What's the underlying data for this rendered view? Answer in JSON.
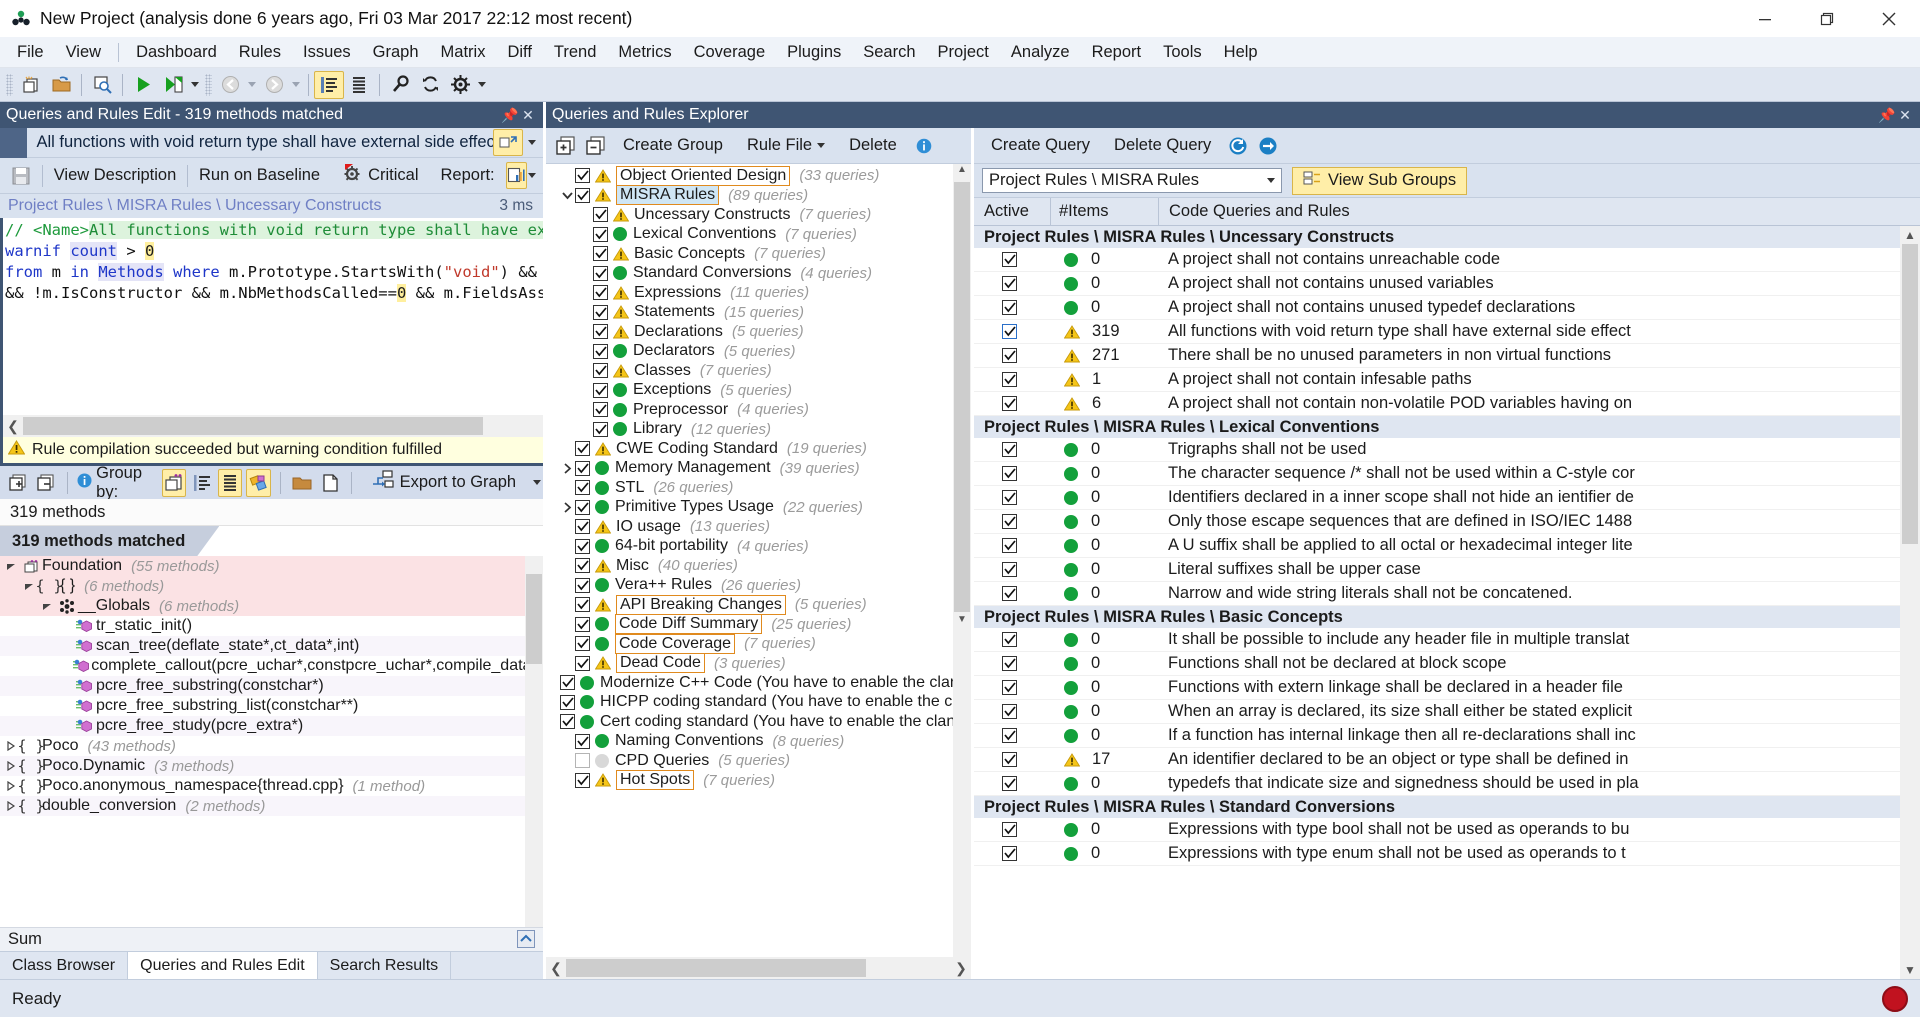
{
  "titlebar": {
    "app_icon": "cppdepend-logo-icon",
    "title": "New Project  (analysis done 6 years ago, Fri 03 Mar 2017  22:12 most recent)",
    "minimize": "—",
    "maximize": "❐",
    "close": "✕"
  },
  "menubar": {
    "items": [
      "File",
      "View",
      "Dashboard",
      "Rules",
      "Issues",
      "Graph",
      "Matrix",
      "Diff",
      "Trend",
      "Metrics",
      "Coverage",
      "Plugins",
      "Search",
      "Project",
      "Analyze",
      "Report",
      "Tools",
      "Help"
    ]
  },
  "left": {
    "panel_title": "Queries and Rules Edit  - 319 methods matched",
    "rule_title": "All functions with void return type shall have external side effect(s)",
    "tools": {
      "save": "",
      "view_description": "View Description",
      "run_on_baseline": "Run on Baseline",
      "critical": "Critical",
      "report": "Report:"
    },
    "breadcrumb": "Project Rules \\ MISRA Rules \\ Uncessary Constructs",
    "duration": "3 ms",
    "code": [
      [
        {
          "t": "// <Name>",
          "c": "c-green"
        },
        {
          "t": "All functions with void return type shall have external s",
          "c": "c-greenbg"
        }
      ],
      [
        {
          "t": "warnif ",
          "c": "c-blue"
        },
        {
          "t": "count",
          "c": "c-kw"
        },
        {
          "t": " > ",
          "c": "c-black"
        },
        {
          "t": "0",
          "c": "c-hl"
        }
      ],
      [
        {
          "t": "from ",
          "c": "c-blue"
        },
        {
          "t": "m ",
          "c": "c-black"
        },
        {
          "t": "in ",
          "c": "c-blue"
        },
        {
          "t": "Methods ",
          "c": "c-kw"
        },
        {
          "t": "where ",
          "c": "c-blue"
        },
        {
          "t": "m.Prototype.StartsWith(",
          "c": "c-black"
        },
        {
          "t": "\"void\"",
          "c": "c-red"
        },
        {
          "t": ") && m.IsPubl",
          "c": "c-black"
        }
      ],
      [
        {
          "t": "&& !m.IsConstructor && m.NbMethodsCalled==",
          "c": "c-black"
        },
        {
          "t": "0",
          "c": "c-hl"
        },
        {
          "t": " && m.FieldsAssigned.Co",
          "c": "c-black"
        }
      ]
    ],
    "warning": "Rule compilation succeeded but warning condition fulfilled",
    "warning_icon": "warning-triangle-icon",
    "groupbar": {
      "group_by_label": "Group by:",
      "info_icon": "info-icon",
      "export_label": "Export to Graph"
    },
    "count_text": "319 methods",
    "matched_text": "319 methods matched",
    "tree": [
      {
        "indent": 0,
        "expander": "open",
        "icon": "project-icon",
        "label": "Foundation",
        "count": "(55 methods)",
        "bg": "pink"
      },
      {
        "indent": 1,
        "expander": "open",
        "icon": "namespace-icon",
        "label": "{ }",
        "count": "(6 methods)",
        "bg": "pink"
      },
      {
        "indent": 2,
        "expander": "open",
        "icon": "globals-icon",
        "label": "__Globals",
        "count": "(6 methods)",
        "bg": "pink"
      },
      {
        "indent": 3,
        "expander": "none",
        "icon": "method-icon",
        "label": "tr_static_init()",
        "count": "",
        "bg": "white"
      },
      {
        "indent": 3,
        "expander": "none",
        "icon": "method-icon",
        "label": "scan_tree(deflate_state*,ct_data*,int)",
        "count": "",
        "bg": "alt"
      },
      {
        "indent": 3,
        "expander": "none",
        "icon": "method-icon",
        "label": "complete_callout(pcre_uchar*,constpcre_uchar*,compile_data*)",
        "count": "",
        "bg": "white"
      },
      {
        "indent": 3,
        "expander": "none",
        "icon": "method-icon",
        "label": "pcre_free_substring(constchar*)",
        "count": "",
        "bg": "alt"
      },
      {
        "indent": 3,
        "expander": "none",
        "icon": "method-icon",
        "label": "pcre_free_substring_list(constchar**)",
        "count": "",
        "bg": "white"
      },
      {
        "indent": 3,
        "expander": "none",
        "icon": "method-icon",
        "label": "pcre_free_study(pcre_extra*)",
        "count": "",
        "bg": "alt"
      },
      {
        "indent": 0,
        "expander": "closed",
        "icon": "namespace-icon",
        "label": "Poco",
        "count": "(43 methods)",
        "bg": "white"
      },
      {
        "indent": 0,
        "expander": "closed",
        "icon": "namespace-icon",
        "label": "Poco.Dynamic",
        "count": "(3 methods)",
        "bg": "alt"
      },
      {
        "indent": 0,
        "expander": "closed",
        "icon": "namespace-icon",
        "label": "Poco.anonymous_namespace{thread.cpp}",
        "count": "(1 method)",
        "bg": "white"
      },
      {
        "indent": 0,
        "expander": "closed",
        "icon": "namespace-icon",
        "label": "double_conversion",
        "count": "(2 methods)",
        "bg": "alt"
      }
    ],
    "sum_label": "Sum",
    "tabs": [
      {
        "label": "Class Browser",
        "active": false
      },
      {
        "label": "Queries and Rules Edit",
        "active": true
      },
      {
        "label": "Search Results",
        "active": false
      }
    ]
  },
  "right": {
    "panel_title": "Queries and Rules Explorer",
    "tree_toolbar": {
      "expand_all": "expand-all-icon",
      "collapse_all": "collapse-all-icon",
      "create_group": "Create Group",
      "rule_file": "Rule File",
      "delete": "Delete",
      "info": "info-icon"
    },
    "query_toolbar": {
      "create_query": "Create Query",
      "delete_query": "Delete Query",
      "refresh": "refresh-icon",
      "forward": "forward-icon"
    },
    "group_selector": "Project Rules \\ MISRA Rules",
    "view_sub_groups": "View Sub Groups",
    "tree": [
      {
        "indent": 0,
        "expander": "none",
        "check": "on",
        "status": "warn",
        "label": "Object Oriented Design",
        "count": "(33 queries)",
        "boxed": "orange"
      },
      {
        "indent": 0,
        "expander": "open",
        "check": "on",
        "status": "warn",
        "label": "MISRA Rules",
        "count": "(89 queries)",
        "boxed": "selected"
      },
      {
        "indent": 1,
        "expander": "none",
        "check": "on",
        "status": "warn",
        "label": "Uncessary Constructs",
        "count": "(7 queries)"
      },
      {
        "indent": 1,
        "expander": "none",
        "check": "on",
        "status": "ok",
        "label": "Lexical Conventions",
        "count": "(7 queries)"
      },
      {
        "indent": 1,
        "expander": "none",
        "check": "on",
        "status": "warn",
        "label": "Basic  Concepts",
        "count": "(7 queries)"
      },
      {
        "indent": 1,
        "expander": "none",
        "check": "on",
        "status": "ok",
        "label": "Standard Conversions",
        "count": "(4 queries)"
      },
      {
        "indent": 1,
        "expander": "none",
        "check": "on",
        "status": "warn",
        "label": "Expressions",
        "count": "(11 queries)"
      },
      {
        "indent": 1,
        "expander": "none",
        "check": "on",
        "status": "warn",
        "label": "Statements",
        "count": "(15 queries)"
      },
      {
        "indent": 1,
        "expander": "none",
        "check": "on",
        "status": "warn",
        "label": "Declarations",
        "count": "(5 queries)"
      },
      {
        "indent": 1,
        "expander": "none",
        "check": "on",
        "status": "ok",
        "label": "Declarators",
        "count": "(5 queries)"
      },
      {
        "indent": 1,
        "expander": "none",
        "check": "on",
        "status": "warn",
        "label": "Classes",
        "count": "(7 queries)"
      },
      {
        "indent": 1,
        "expander": "none",
        "check": "on",
        "status": "ok",
        "label": "Exceptions",
        "count": "(5 queries)"
      },
      {
        "indent": 1,
        "expander": "none",
        "check": "on",
        "status": "ok",
        "label": "Preprocessor",
        "count": "(4 queries)"
      },
      {
        "indent": 1,
        "expander": "none",
        "check": "on",
        "status": "ok",
        "label": "Library",
        "count": "(12 queries)"
      },
      {
        "indent": 0,
        "expander": "none",
        "check": "on",
        "status": "warn",
        "label": "CWE Coding Standard",
        "count": "(19 queries)"
      },
      {
        "indent": 0,
        "expander": "closed",
        "check": "on",
        "status": "ok",
        "label": "Memory Management",
        "count": "(39 queries)"
      },
      {
        "indent": 0,
        "expander": "none",
        "check": "on",
        "status": "ok",
        "label": "STL",
        "count": "(26 queries)"
      },
      {
        "indent": 0,
        "expander": "closed",
        "check": "on",
        "status": "ok",
        "label": "Primitive Types Usage",
        "count": "(22 queries)"
      },
      {
        "indent": 0,
        "expander": "none",
        "check": "on",
        "status": "warn",
        "label": "IO usage",
        "count": "(13 queries)"
      },
      {
        "indent": 0,
        "expander": "none",
        "check": "on",
        "status": "ok",
        "label": "64-bit portability",
        "count": "(4 queries)"
      },
      {
        "indent": 0,
        "expander": "none",
        "check": "on",
        "status": "warn",
        "label": "Misc",
        "count": "(40 queries)"
      },
      {
        "indent": 0,
        "expander": "none",
        "check": "on",
        "status": "ok",
        "label": "Vera++ Rules",
        "count": "(26 queries)"
      },
      {
        "indent": 0,
        "expander": "none",
        "check": "on",
        "status": "warn",
        "label": "API Breaking Changes",
        "count": "(5 queries)",
        "boxed": "orange"
      },
      {
        "indent": 0,
        "expander": "none",
        "check": "on",
        "status": "ok",
        "label": "Code Diff Summary",
        "count": "(25 queries)",
        "boxed": "orange"
      },
      {
        "indent": 0,
        "expander": "none",
        "check": "on",
        "status": "ok",
        "label": "Code Coverage",
        "count": "(7 queries)",
        "boxed": "orange"
      },
      {
        "indent": 0,
        "expander": "none",
        "check": "on",
        "status": "warn",
        "label": "Dead Code",
        "count": "(3 queries)",
        "boxed": "orange"
      },
      {
        "indent": 0,
        "expander": "none",
        "check": "on",
        "status": "ok",
        "label": "Modernize C++ Code (You have to enable the clang-tid",
        "count": ""
      },
      {
        "indent": 0,
        "expander": "none",
        "check": "on",
        "status": "ok",
        "label": "HICPP coding standard (You have to enable the clang-ti",
        "count": ""
      },
      {
        "indent": 0,
        "expander": "none",
        "check": "on",
        "status": "ok",
        "label": "Cert coding standard (You have to enable the clang-tidy",
        "count": ""
      },
      {
        "indent": 0,
        "expander": "none",
        "check": "on",
        "status": "ok",
        "label": "Naming Conventions",
        "count": "(8 queries)"
      },
      {
        "indent": 0,
        "expander": "none",
        "check": "off",
        "status": "none",
        "label": "CPD Queries",
        "count": "(5 queries)"
      },
      {
        "indent": 0,
        "expander": "none",
        "check": "on",
        "status": "warn",
        "label": "Hot Spots",
        "count": "(7 queries)",
        "boxed": "orange"
      }
    ],
    "table": {
      "headers": [
        "Active",
        "#Items",
        "Code Queries and Rules"
      ],
      "sections": [
        {
          "title": "Project Rules \\ MISRA Rules \\ Uncessary Constructs",
          "rows": [
            {
              "active": true,
              "status": "ok",
              "items": "0",
              "rule": "A project shall not contains unreachable code",
              "selected": false
            },
            {
              "active": true,
              "status": "ok",
              "items": "0",
              "rule": "A project shall not contains unused variables",
              "selected": false
            },
            {
              "active": true,
              "status": "ok",
              "items": "0",
              "rule": "A project shall not contains unused typedef declarations",
              "selected": false
            },
            {
              "active": true,
              "status": "warn",
              "items": "319",
              "rule": "All functions with void return type shall have external side effect",
              "selected": true
            },
            {
              "active": true,
              "status": "warn",
              "items": "271",
              "rule": "There shall be no unused parameters in non virtual functions",
              "selected": false
            },
            {
              "active": true,
              "status": "warn",
              "items": "1",
              "rule": "A project shall not contain infesable paths",
              "selected": false
            },
            {
              "active": true,
              "status": "warn",
              "items": "6",
              "rule": "A project shall not contain non-volatile POD variables having on",
              "selected": false
            }
          ]
        },
        {
          "title": "Project Rules \\ MISRA Rules \\ Lexical Conventions",
          "rows": [
            {
              "active": true,
              "status": "ok",
              "items": "0",
              "rule": "Trigraphs shall not be used",
              "selected": false
            },
            {
              "active": true,
              "status": "ok",
              "items": "0",
              "rule": "The character sequence /* shall not be used within a C-style cor",
              "selected": false
            },
            {
              "active": true,
              "status": "ok",
              "items": "0",
              "rule": "Identifiers declared in a inner scope shall not hide an ientifier de",
              "selected": false
            },
            {
              "active": true,
              "status": "ok",
              "items": "0",
              "rule": "Only those escape sequences that are defined  in ISO/IEC 1488",
              "selected": false
            },
            {
              "active": true,
              "status": "ok",
              "items": "0",
              "rule": "A U suffix shall be applied to all octal or hexadecimal integer lite",
              "selected": false
            },
            {
              "active": true,
              "status": "ok",
              "items": "0",
              "rule": "Literal suffixes shall be upper case",
              "selected": false
            },
            {
              "active": true,
              "status": "ok",
              "items": "0",
              "rule": "Narrow and wide string literals shall not be concatened.",
              "selected": false
            }
          ]
        },
        {
          "title": "Project Rules \\ MISRA Rules \\ Basic  Concepts",
          "rows": [
            {
              "active": true,
              "status": "ok",
              "items": "0",
              "rule": "It shall be possible to include any header file in multiple translat",
              "selected": false
            },
            {
              "active": true,
              "status": "ok",
              "items": "0",
              "rule": "Functions shall not be declared at block scope",
              "selected": false
            },
            {
              "active": true,
              "status": "ok",
              "items": "0",
              "rule": "Functions with extern linkage shall be declared in a header file",
              "selected": false
            },
            {
              "active": true,
              "status": "ok",
              "items": "0",
              "rule": "When an array is declared, its size shall either be stated explicit",
              "selected": false
            },
            {
              "active": true,
              "status": "ok",
              "items": "0",
              "rule": "If a function has internal linkage then all re-declarations shall inc",
              "selected": false
            },
            {
              "active": true,
              "status": "warn",
              "items": "17",
              "rule": "An identifier declared to be an object or type shall be defined in",
              "selected": false
            },
            {
              "active": true,
              "status": "ok",
              "items": "0",
              "rule": "typedefs that indicate size and signedness should be used in pla",
              "selected": false
            }
          ]
        },
        {
          "title": "Project Rules \\ MISRA Rules \\ Standard Conversions",
          "rows": [
            {
              "active": true,
              "status": "ok",
              "items": "0",
              "rule": "Expressions with type bool shall not be used as operands to bu",
              "selected": false
            },
            {
              "active": true,
              "status": "ok",
              "items": "0",
              "rule": "Expressions with type enum shall not be used as operands to t",
              "selected": false
            }
          ]
        }
      ]
    }
  },
  "statusbar": {
    "text": "Ready",
    "record_indicator": "record-dot-icon"
  },
  "colors": {
    "panel_header": "#3f5573",
    "toolbar_bg": "#dfe6f1",
    "accent_yellow": "#ffeea8",
    "status_ok": "#13a03b",
    "status_warn": "#f5c518",
    "selection_blue": "#cfe6f5",
    "highlight_orange": "#e08a1e",
    "record_red": "#c1121f"
  }
}
